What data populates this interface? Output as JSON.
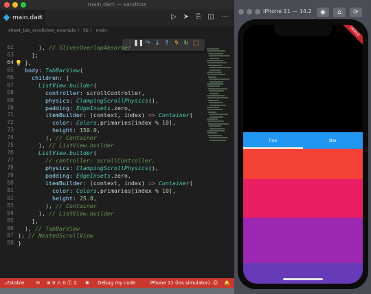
{
  "vscode": {
    "window_title": "main.dart — sandbox",
    "file_tab": "main.dart",
    "breadcrumb": "sheet_tab_scrollview_example 〉 lib 〉 main",
    "line_numbers": [
      "62",
      "63",
      "64",
      "65",
      "66",
      "67",
      "68",
      "69",
      "70",
      "71",
      "72",
      "73",
      "74",
      "75",
      "76",
      "77",
      "78",
      "79",
      "80",
      "81",
      "82",
      "83",
      "84",
      "85",
      "86",
      "87",
      "88"
    ],
    "code_lines": [
      "      ), // SliverOverlapAbsorber",
      "    ];",
      "  },",
      "  body: TabBarView(",
      "    children: [",
      "      ListView.builder(",
      "        controller: scrollController,",
      "        physics: ClampingScrollPhysics(),",
      "        padding: EdgeInsets.zero,",
      "        itemBuilder: (context, index) => Container(",
      "          color: Colors.primaries[index % 10],",
      "          height: 150.0,",
      "        ), // Container",
      "      ), // ListView.builder",
      "      ListView.builder(",
      "        // controller: scrollController,",
      "        physics: ClampingScrollPhysics(),",
      "        padding: EdgeInsets.zero,",
      "        itemBuilder: (context, index) => Container(",
      "          color: Colors.primaries[index % 10],",
      "          height: 25.0,",
      "        ), // Container",
      "      ), // ListView.builder",
      "    ],",
      "  ), // TabBarView",
      "); // NestedScrollView",
      "}"
    ],
    "status": {
      "branch": "stable",
      "problems": "⊗ 0 ⚠ 0 ⓘ 2",
      "debug_mode": "Debug my code",
      "device": "iPhone 11 (ios simulator)"
    }
  },
  "simulator": {
    "title": "iPhone 11 — 14.2",
    "debug_banner": "DEBUG",
    "tabs": [
      "Foo",
      "Bar"
    ],
    "colors": {
      "tab_bar": "#2196f3",
      "stripes": [
        "#f44336",
        "#e91e63",
        "#9c27b0",
        "#673ab7"
      ]
    }
  }
}
